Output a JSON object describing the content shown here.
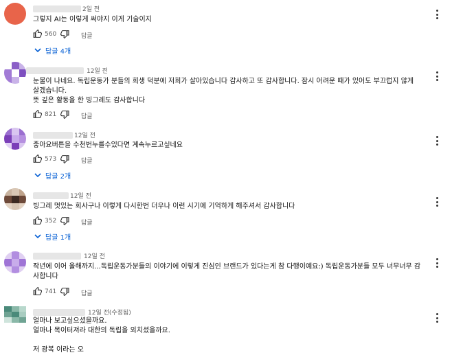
{
  "comments": [
    {
      "timestamp": "2일 전",
      "lines": [
        "그렇지 AI는 이렇게 써야지  이게 기술이지"
      ],
      "likes": "560",
      "reply_label": "답글",
      "replies_label": "답글 4개",
      "avatar_colors": [
        "#e8644a",
        "#e8644a",
        "#e8644a",
        "#e8644a",
        "#d85a3c",
        "#e8644a",
        "#e8644a",
        "#e8644a",
        "#e8644a"
      ]
    },
    {
      "timestamp": "12일 전",
      "lines": [
        "눈물이 나네요. 독립운동가 분들의 희생 덕분에 저희가 살아있습니다 감사하고 또 감사합니다. 잠시 어려운 때가  있어도 부끄럽지 않게 살겠습니다.",
        "뜻 깊은 활동을 한 빙그레도 감사합니다"
      ],
      "likes": "821",
      "reply_label": "답글",
      "replies_label": "",
      "avatar_colors": [
        "#ffffff",
        "#8b5fc7",
        "#c9b3e8",
        "#a27bd6",
        "#ffffff",
        "#7d4fbf",
        "#a27bd6",
        "#c9b3e8",
        "#ffffff"
      ]
    },
    {
      "timestamp": "12일 전",
      "lines": [
        "좋아요버튼을 수천번누를수있다면 계속누르고싶네요"
      ],
      "likes": "573",
      "reply_label": "답글",
      "replies_label": "답글 2개",
      "avatar_colors": [
        "#9b6fd0",
        "#d9c6f0",
        "#9b6fd0",
        "#7b3fb8",
        "#c7a9ea",
        "#b690e0",
        "#e3d3f5",
        "#7b3fb8",
        "#d9c6f0"
      ]
    },
    {
      "timestamp": "12일 전",
      "lines": [
        "빙그레 멋있는 회사구나  이렇게 다시한번 더우나 이런 시기에 기억하게 해주셔서 감사합니다"
      ],
      "likes": "352",
      "reply_label": "답글",
      "replies_label": "답글 1개",
      "avatar_colors": [
        "#c9b4a0",
        "#d8c6b4",
        "#c0a48c",
        "#6e4a3a",
        "#3c2a22",
        "#6e4a3a",
        "#e4d4c4",
        "#d8c6b4",
        "#e4d4c4"
      ]
    },
    {
      "timestamp": "12일 전",
      "lines": [
        "작년에 이어 올해까지...독립운동가분들의 이야기에 이렇게 진심인 브랜드가 있다는게 참 다행이예요:) 독립운동가분들 모두 너무너무 감사합니다"
      ],
      "likes": "741",
      "reply_label": "답글",
      "replies_label": "",
      "avatar_colors": [
        "#e0d0f2",
        "#b28ee0",
        "#e0d0f2",
        "#9f74d6",
        "#c8acea",
        "#9f74d6",
        "#e0d0f2",
        "#b28ee0",
        "#e0d0f2"
      ]
    },
    {
      "timestamp": "12일 전(수정됨)",
      "lines": [
        "얼마나 보고싶으셨을까요.",
        "얼마나 목이터져라 대한의 독립을 외치셨을까요.",
        "",
        "저 광복  이라는 오"
      ],
      "likes": "",
      "reply_label": "",
      "replies_label": "",
      "avatar_colors": [
        "#4a8a7a",
        "#8ab8a8",
        "#b8d8cc",
        "#6fa393",
        "#4a8a7a",
        "#a8ccc0",
        "#cfe4dc",
        "#8ab8a8",
        "#6fa393"
      ]
    }
  ]
}
